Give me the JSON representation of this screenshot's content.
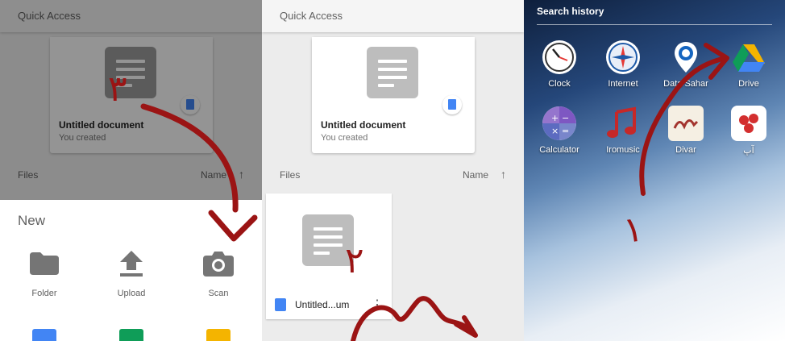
{
  "left_panel": {
    "quick_access_title": "Quick Access",
    "card": {
      "name": "Untitled document",
      "subtitle": "You created"
    },
    "files_label": "Files",
    "sort_label": "Name",
    "new_sheet": {
      "title": "New",
      "options": [
        {
          "label": "Folder",
          "icon": "folder-icon"
        },
        {
          "label": "Upload",
          "icon": "upload-icon"
        },
        {
          "label": "Scan",
          "icon": "camera-icon"
        }
      ]
    }
  },
  "middle_panel": {
    "quick_access_title": "Quick Access",
    "card": {
      "name": "Untitled document",
      "subtitle": "You created"
    },
    "files_label": "Files",
    "sort_label": "Name",
    "file": {
      "name": "Untitled...um"
    }
  },
  "right_panel": {
    "search_history_title": "Search history",
    "apps": [
      {
        "label": "Clock",
        "icon": "clock-icon"
      },
      {
        "label": "Internet",
        "icon": "compass-icon"
      },
      {
        "label": "Data Sahar",
        "icon": "location-pin-icon"
      },
      {
        "label": "Drive",
        "icon": "google-drive-icon"
      },
      {
        "label": "Calculator",
        "icon": "calculator-icon"
      },
      {
        "label": "Iromusic",
        "icon": "music-note-icon"
      },
      {
        "label": "Divar",
        "icon": "divar-icon"
      },
      {
        "label": "آپ",
        "icon": "app-red-icon"
      }
    ]
  },
  "annotations": {
    "step1": "١",
    "step2": "٢",
    "step3": "٣"
  },
  "colors": {
    "annotation": "#9b1414",
    "drive_blue": "#4285f4",
    "drive_green": "#0f9d58",
    "drive_yellow": "#f4b400"
  }
}
